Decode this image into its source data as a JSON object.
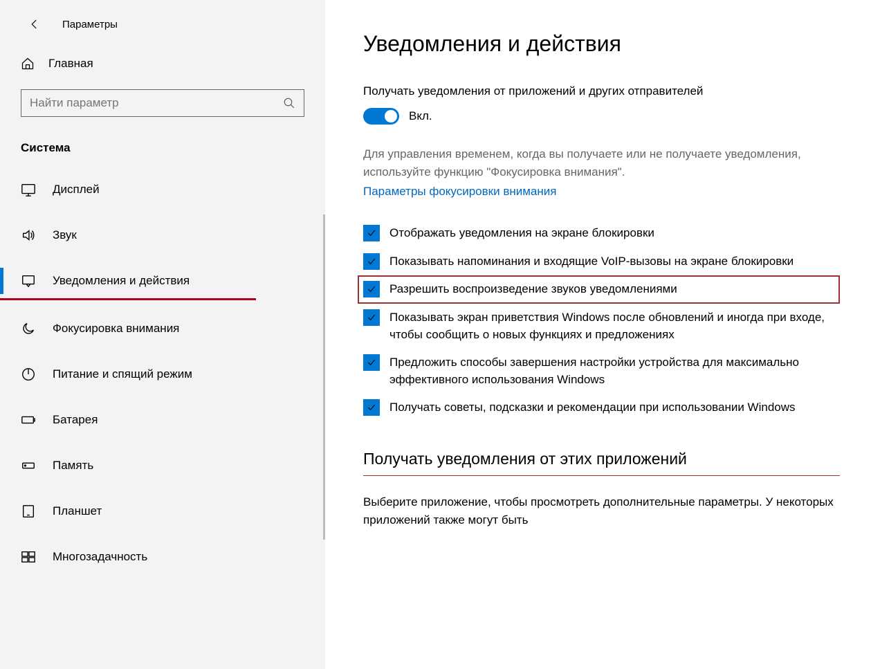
{
  "header": {
    "title": "Параметры"
  },
  "sidebar": {
    "home_label": "Главная",
    "search_placeholder": "Найти параметр",
    "section_title": "Система",
    "items": [
      {
        "label": "Дисплей"
      },
      {
        "label": "Звук"
      },
      {
        "label": "Уведомления и действия"
      },
      {
        "label": "Фокусировка внимания"
      },
      {
        "label": "Питание и спящий режим"
      },
      {
        "label": "Батарея"
      },
      {
        "label": "Память"
      },
      {
        "label": "Планшет"
      },
      {
        "label": "Многозадачность"
      }
    ]
  },
  "main": {
    "title": "Уведомления и действия",
    "get_notifications_label": "Получать уведомления от приложений и других отправителей",
    "toggle_state": "Вкл.",
    "focus_desc": "Для управления временем, когда вы получаете или не получаете уведомления, используйте функцию \"Фокусировка внимания\".",
    "focus_link": "Параметры фокусировки внимания",
    "checkboxes": [
      {
        "label": "Отображать уведомления на экране блокировки"
      },
      {
        "label": "Показывать напоминания и входящие VoIP-вызовы на экране блокировки"
      },
      {
        "label": "Разрешить  воспроизведение звуков уведомлениями"
      },
      {
        "label": "Показывать экран приветствия Windows после обновлений и иногда при входе, чтобы сообщить о новых функциях и предложениях"
      },
      {
        "label": "Предложить способы завершения настройки устройства для максимально эффективного использования Windows"
      },
      {
        "label": "Получать советы, подсказки и рекомендации при использовании Windows"
      }
    ],
    "apps_heading": "Получать уведомления от этих приложений",
    "apps_desc": "Выберите приложение, чтобы просмотреть дополнительные параметры. У некоторых приложений также могут быть"
  }
}
